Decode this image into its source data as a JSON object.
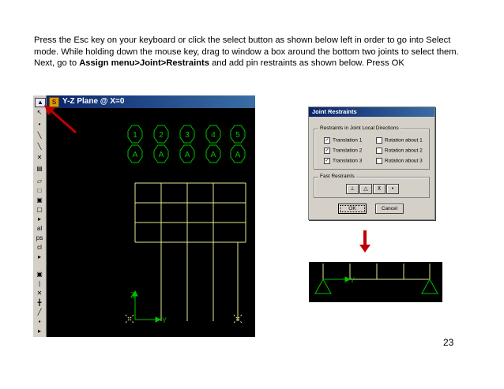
{
  "instructions": {
    "part1": "Press the Esc key on your keyboard or click the select button as shown below left in order to go into Select mode. While holding down the mouse key, drag to window a box around the bottom two joints to select them. Next, go to ",
    "menu_path": "Assign menu>Joint>Restraints",
    "part2": " and add pin restraints as shown below. Press OK"
  },
  "sap_window": {
    "title": "Y-Z Plane @ X=0",
    "grid_bubbles_top": [
      "1",
      "2",
      "3",
      "4",
      "5"
    ],
    "grid_bubbles_bottom": [
      "A",
      "A",
      "A",
      "A",
      "A"
    ],
    "axis_z": "Z",
    "axis_y": "Y"
  },
  "dialog": {
    "title": "Joint Restraints",
    "group_directions": "Restraints in Joint Local Directions",
    "translation_1": "Translation  1",
    "translation_2": "Translation  2",
    "translation_3": "Translation  3",
    "rotation_1": "Rotation about  1",
    "rotation_2": "Rotation about  2",
    "rotation_3": "Rotation about  3",
    "group_fast": "Fast Restraints",
    "ok": "OK",
    "cancel": "Cancel"
  },
  "result_view": {
    "axis_y": "Y"
  },
  "colors": {
    "arrow_red": "#c00000",
    "frame_yellow": "#e8e890",
    "bubble_green": "#00c000",
    "support_green": "#00c000"
  },
  "page_number": "23"
}
